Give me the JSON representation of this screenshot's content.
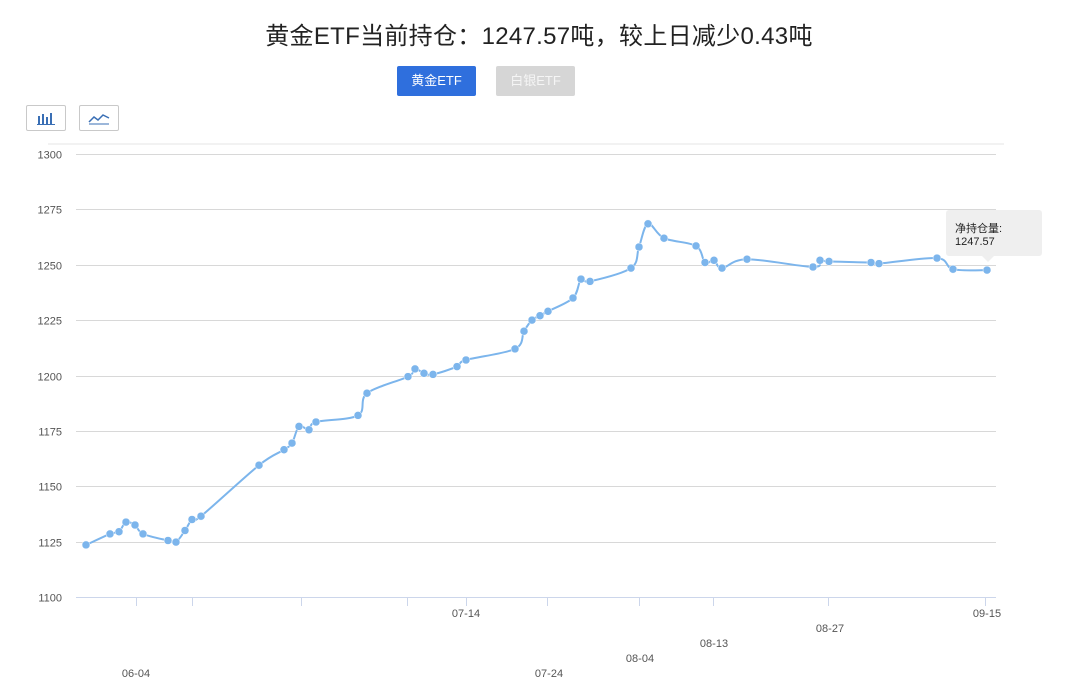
{
  "header": {
    "title": "黄金ETF当前持仓：1247.57吨，较上日减少0.43吨"
  },
  "tabs": [
    {
      "label": "黄金ETF",
      "active": true
    },
    {
      "label": "白银ETF",
      "active": false
    }
  ],
  "chart_type_buttons": [
    {
      "icon": "bar-chart-icon"
    },
    {
      "icon": "line-chart-icon"
    }
  ],
  "tooltip": {
    "label": "净持仓量:",
    "value": "1247.57"
  },
  "colors": {
    "line": "#7cb5ec",
    "tab_active": "#2f6fdd",
    "tab_inactive": "#d6d6d6",
    "grid": "#d8d8d8"
  },
  "chart_data": {
    "type": "line",
    "title": "黄金ETF当前持仓：1247.57吨，较上日减少0.43吨",
    "ylim": [
      1100,
      1300
    ],
    "yticks": [
      1100,
      1125,
      1150,
      1175,
      1200,
      1225,
      1250,
      1275,
      1300
    ],
    "x_tick_labels": [
      "06-04",
      "07-14",
      "07-24",
      "08-04",
      "08-13",
      "08-27",
      "09-15"
    ],
    "grid": true,
    "series": [
      {
        "values": [
          1123.5,
          1128.5,
          1129.5,
          1133.8,
          1132.5,
          1128.5,
          1125.5,
          1124.8,
          1130.0,
          1135.0,
          1136.5,
          1159.5,
          1166.5,
          1169.5,
          1177.0,
          1175.5,
          1179.0,
          1182.0,
          1192.0,
          1199.5,
          1203.0,
          1201.0,
          1200.5,
          1204.0,
          1207.0,
          1212.0,
          1220.0,
          1225.0,
          1227.0,
          1229.0,
          1235.0,
          1243.5,
          1242.5,
          1248.5,
          1258.0,
          1268.5,
          1262.0,
          1258.5,
          1251.0,
          1252.0,
          1248.5,
          1252.5,
          1249.0,
          1252.0,
          1251.5,
          1251.0,
          1250.5,
          1253.0,
          1248.0,
          1247.57
        ]
      }
    ]
  }
}
